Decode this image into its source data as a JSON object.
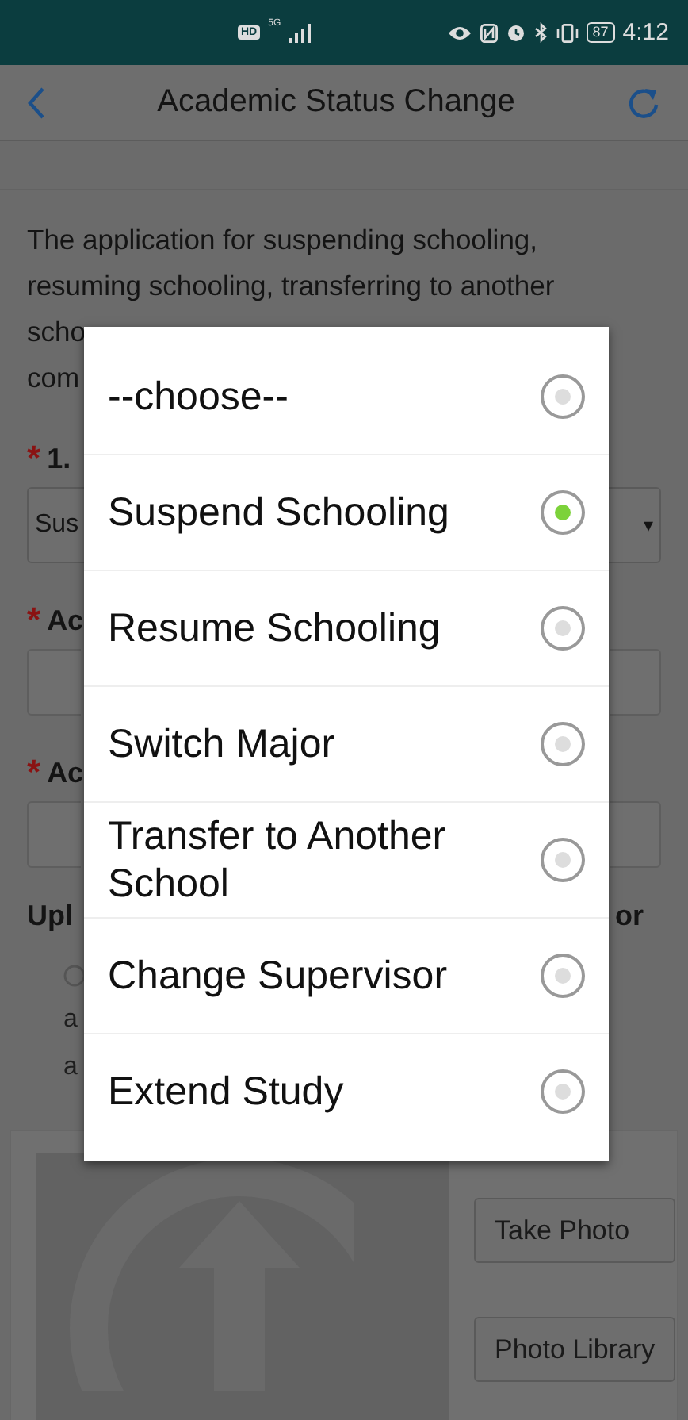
{
  "status_bar": {
    "hd": "HD",
    "network": "5G",
    "battery": "87",
    "time": "4:12"
  },
  "header": {
    "title": "Academic Status Change"
  },
  "intro": [
    "The application for suspending schooling,",
    "resuming schooling, transferring to another",
    "scho",
    "com"
  ],
  "fields": [
    {
      "kind": "select",
      "mark": "*",
      "label": "1.",
      "value": "Sus",
      "caret": "▾"
    },
    {
      "kind": "input",
      "mark": "*",
      "label": "Ac"
    },
    {
      "kind": "input",
      "mark": "*",
      "label": "Ac"
    }
  ],
  "upload": {
    "title_start": "Upl",
    "title_end": "or",
    "notes": [
      "a",
      "a"
    ],
    "buttons": [
      "Take Photo",
      "Photo Library"
    ]
  },
  "dialog": {
    "options": [
      {
        "label": "--choose--",
        "selected": false
      },
      {
        "label": "Suspend Schooling",
        "selected": true
      },
      {
        "label": "Resume Schooling",
        "selected": false
      },
      {
        "label": "Switch Major",
        "selected": false
      },
      {
        "label": "Transfer to Another School",
        "selected": false
      },
      {
        "label": "Change Supervisor",
        "selected": false
      },
      {
        "label": "Extend Study",
        "selected": false
      }
    ]
  }
}
